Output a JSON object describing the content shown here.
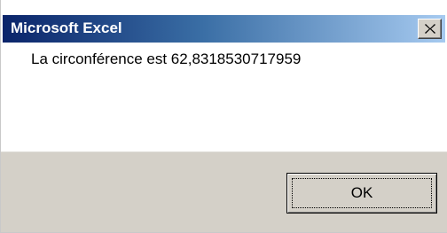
{
  "dialog": {
    "title": "Microsoft Excel",
    "message": "La circonférence est 62,8318530717959",
    "ok_label": "OK",
    "close_icon": "close-icon"
  },
  "colors": {
    "titlebar_start": "#0a246a",
    "titlebar_end": "#a6caf0",
    "button_face": "#d4d0c8"
  }
}
